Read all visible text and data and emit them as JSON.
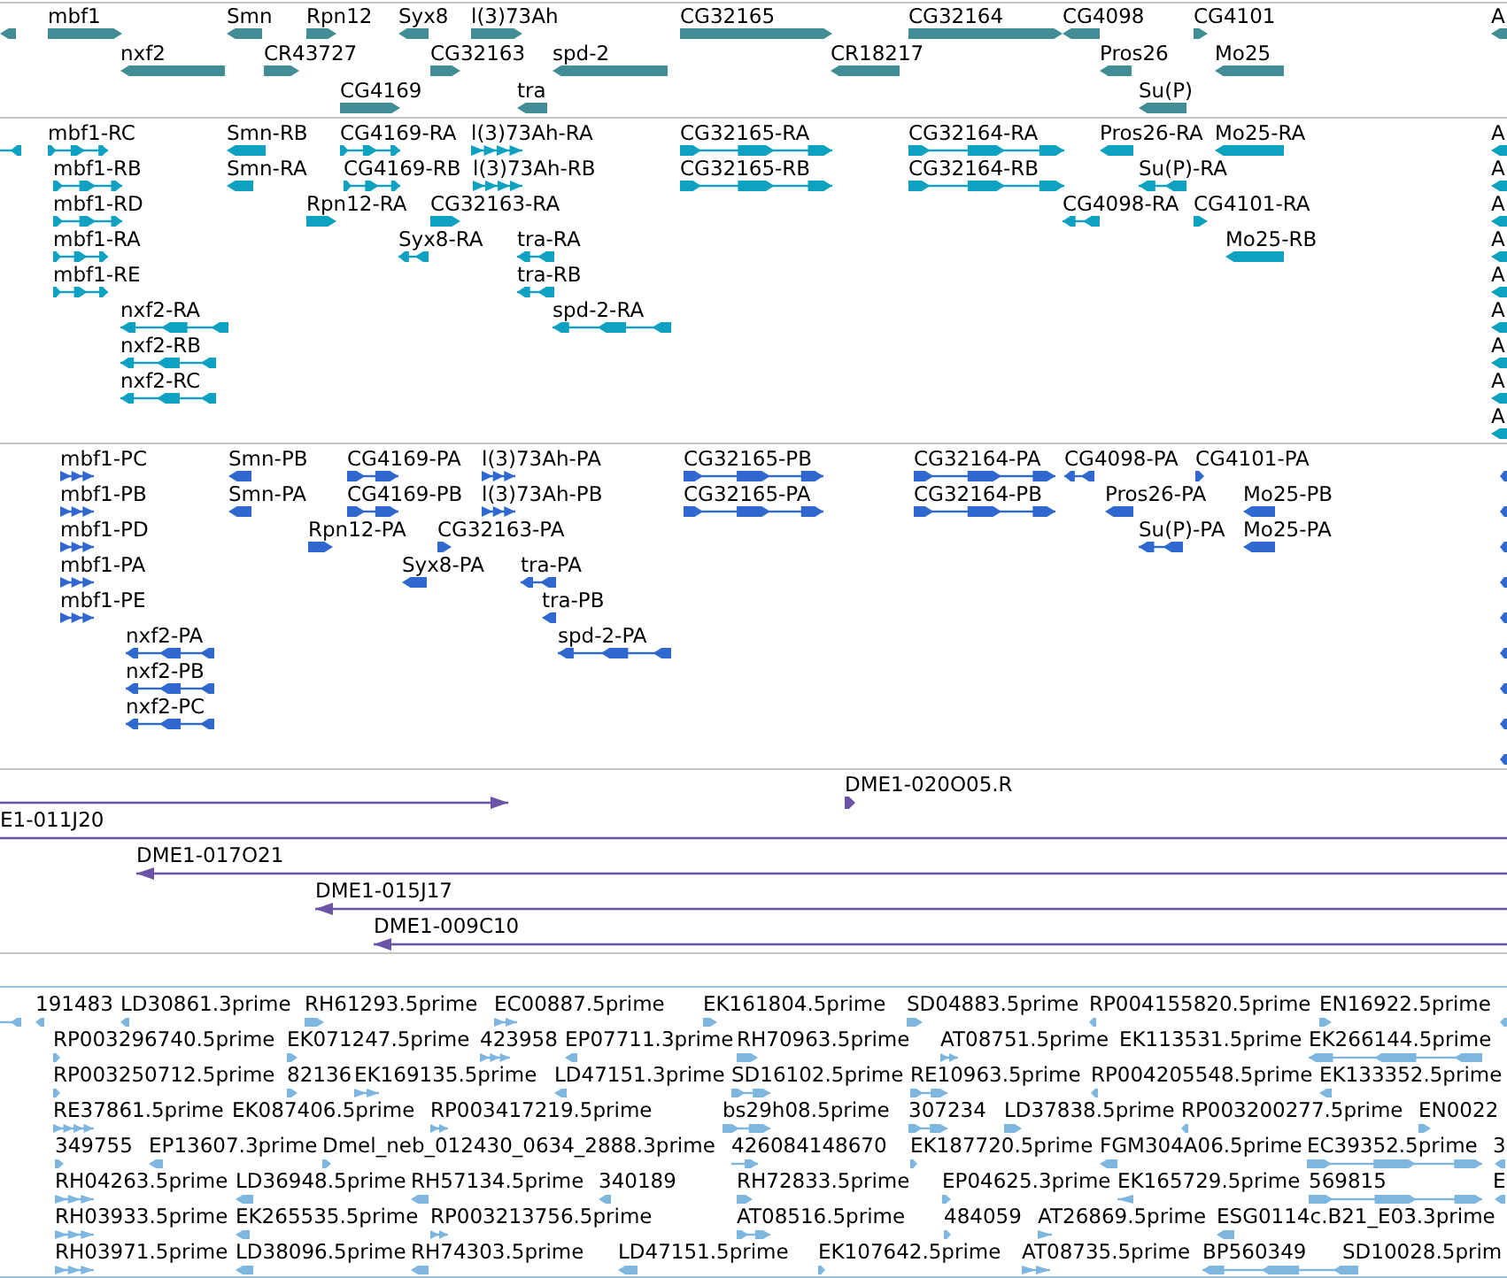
{
  "tracks": [
    {
      "kind": "gene",
      "features": [
        {
          "forward": false
        },
        {
          "label": "mbf1",
          "forward": true
        },
        {
          "label": "Smn",
          "forward": false
        },
        {
          "label": "Rpn12",
          "forward": true
        },
        {
          "label": "Syx8",
          "forward": false
        },
        {
          "label": "l(3)73Ah",
          "forward": true
        },
        {
          "label": "CG32165",
          "forward": true
        },
        {
          "label": "CG32164",
          "forward": true
        },
        {
          "label": "CG4098",
          "forward": false
        },
        {
          "label": "CG4101",
          "forward": true
        },
        {
          "label": "A",
          "forward": false
        },
        {
          "label": "nxf2",
          "forward": false
        },
        {
          "label": "CR43727",
          "forward": true
        },
        {
          "label": "CG32163",
          "forward": true
        },
        {
          "label": "spd-2",
          "forward": false
        },
        {
          "label": "CR18217",
          "forward": false
        },
        {
          "label": "Pros26",
          "forward": false
        },
        {
          "label": "Mo25",
          "forward": false
        },
        {
          "label": "CG4169",
          "forward": true
        },
        {
          "label": "tra",
          "forward": false
        },
        {
          "label": "Su(P)",
          "forward": false
        }
      ]
    },
    {
      "kind": "transcript",
      "features": [
        {
          "forward": false
        },
        {
          "label": "mbf1-RC",
          "forward": true
        },
        {
          "label": "Smn-RB",
          "forward": false
        },
        {
          "label": "CG4169-RA",
          "forward": true
        },
        {
          "label": "l(3)73Ah-RA",
          "forward": true
        },
        {
          "label": "CG32165-RA",
          "forward": true
        },
        {
          "label": "CG32164-RA",
          "forward": true
        },
        {
          "label": "Pros26-RA",
          "forward": false
        },
        {
          "label": "Mo25-RA",
          "forward": false
        },
        {
          "label": "A",
          "forward": false
        },
        {
          "label": "mbf1-RB",
          "forward": true
        },
        {
          "label": "Smn-RA",
          "forward": false
        },
        {
          "label": "CG4169-RB",
          "forward": true
        },
        {
          "label": "l(3)73Ah-RB",
          "forward": true
        },
        {
          "label": "CG32165-RB",
          "forward": true
        },
        {
          "label": "CG32164-RB",
          "forward": true
        },
        {
          "label": "Su(P)-RA",
          "forward": false
        },
        {
          "label": "A",
          "forward": false
        },
        {
          "label": "mbf1-RD",
          "forward": true
        },
        {
          "label": "Rpn12-RA",
          "forward": true
        },
        {
          "label": "CG32163-RA",
          "forward": true
        },
        {
          "label": "CG4098-RA",
          "forward": false
        },
        {
          "label": "CG4101-RA",
          "forward": true
        },
        {
          "label": "A",
          "forward": false
        },
        {
          "label": "mbf1-RA",
          "forward": true
        },
        {
          "label": "Syx8-RA",
          "forward": false
        },
        {
          "label": "tra-RA",
          "forward": false
        },
        {
          "label": "Mo25-RB",
          "forward": false
        },
        {
          "label": "A",
          "forward": false
        },
        {
          "label": "mbf1-RE",
          "forward": true
        },
        {
          "label": "tra-RB",
          "forward": false
        },
        {
          "label": "A",
          "forward": false
        },
        {
          "label": "nxf2-RA",
          "forward": false
        },
        {
          "label": "spd-2-RA",
          "forward": false
        },
        {
          "label": "A",
          "forward": false
        },
        {
          "label": "nxf2-RB",
          "forward": false
        },
        {
          "label": "A",
          "forward": false
        },
        {
          "label": "nxf2-RC",
          "forward": false
        },
        {
          "label": "A",
          "forward": false
        },
        {
          "label": "A",
          "forward": false
        }
      ]
    },
    {
      "kind": "protein",
      "features": [
        {
          "label": "mbf1-PC",
          "forward": true
        },
        {
          "label": "Smn-PB",
          "forward": false
        },
        {
          "label": "CG4169-PA",
          "forward": true
        },
        {
          "label": "l(3)73Ah-PA",
          "forward": true
        },
        {
          "label": "CG32165-PB",
          "forward": true
        },
        {
          "label": "CG32164-PA",
          "forward": true
        },
        {
          "label": "CG4098-PA",
          "forward": false
        },
        {
          "label": "CG4101-PA",
          "forward": true
        },
        {
          "forward": false
        },
        {
          "label": "mbf1-PB",
          "forward": true
        },
        {
          "label": "Smn-PA",
          "forward": false
        },
        {
          "label": "CG4169-PB",
          "forward": true
        },
        {
          "label": "l(3)73Ah-PB",
          "forward": true
        },
        {
          "label": "CG32165-PA",
          "forward": true
        },
        {
          "label": "CG32164-PB",
          "forward": true
        },
        {
          "label": "Pros26-PA",
          "forward": false
        },
        {
          "label": "Mo25-PB",
          "forward": false
        },
        {
          "forward": false
        },
        {
          "label": "mbf1-PD",
          "forward": true
        },
        {
          "label": "Rpn12-PA",
          "forward": true
        },
        {
          "label": "CG32163-PA",
          "forward": true
        },
        {
          "label": "Su(P)-PA",
          "forward": false
        },
        {
          "label": "Mo25-PA",
          "forward": false
        },
        {
          "forward": false
        },
        {
          "label": "mbf1-PA",
          "forward": true
        },
        {
          "label": "Syx8-PA",
          "forward": false
        },
        {
          "label": "tra-PA",
          "forward": false
        },
        {
          "forward": false
        },
        {
          "label": "mbf1-PE",
          "forward": true
        },
        {
          "label": "tra-PB",
          "forward": false
        },
        {
          "forward": false
        },
        {
          "label": "nxf2-PA",
          "forward": false
        },
        {
          "label": "spd-2-PA",
          "forward": false
        },
        {
          "forward": false
        },
        {
          "label": "nxf2-PB",
          "forward": false
        },
        {
          "forward": false
        },
        {
          "label": "nxf2-PC",
          "forward": false
        },
        {
          "forward": false
        },
        {
          "forward": false
        }
      ]
    },
    {
      "kind": "clone",
      "features": [
        {
          "forward": true
        },
        {
          "label": "DME1-020O05.R",
          "forward": true
        },
        {
          "label": "E1-011J20"
        },
        {
          "label": "DME1-017O21",
          "forward": false
        },
        {
          "label": "DME1-015J17",
          "forward": false
        },
        {
          "label": "DME1-009C10",
          "forward": false
        }
      ]
    },
    {
      "kind": "est",
      "features": [
        {
          "forward": false
        },
        {
          "label": "191483",
          "forward": false
        },
        {
          "label": "LD30861.3prime",
          "forward": false
        },
        {
          "label": "RH61293.5prime",
          "forward": true
        },
        {
          "label": "EC00887.5prime",
          "forward": true
        },
        {
          "label": "EK161804.5prime",
          "forward": true
        },
        {
          "label": "SD04883.5prime",
          "forward": true
        },
        {
          "label": "RP004155820.5prime",
          "forward": false
        },
        {
          "label": "EN16922.5prime",
          "forward": true
        },
        {
          "forward": false
        },
        {
          "label": "RP003296740.5prime",
          "forward": true
        },
        {
          "label": "EK071247.5prime",
          "forward": true
        },
        {
          "label": "423958",
          "forward": true
        },
        {
          "label": "EP07711.3prime",
          "forward": false
        },
        {
          "label": "RH70963.5prime",
          "forward": true
        },
        {
          "label": "AT08751.5prime",
          "forward": true
        },
        {
          "label": "EK113531.5prime"
        },
        {
          "label": "EK266144.5prime",
          "forward": false
        },
        {
          "label": "RP003250712.5prime",
          "forward": true
        },
        {
          "label": "82136",
          "forward": true
        },
        {
          "label": "EK169135.5prime",
          "forward": true
        },
        {
          "label": "LD47151.3prime",
          "forward": false
        },
        {
          "label": "SD16102.5prime",
          "forward": true
        },
        {
          "label": "RE10963.5prime",
          "forward": true
        },
        {
          "label": "RP004205548.5prime",
          "forward": false
        },
        {
          "label": "EK133352.5prime",
          "forward": false
        },
        {
          "label": "RE37861.5prime",
          "forward": true
        },
        {
          "label": "EK087406.5prime"
        },
        {
          "label": "RP003417219.5prime",
          "forward": true
        },
        {
          "label": "bs29h08.5prime",
          "forward": true
        },
        {
          "label": "307234",
          "forward": true
        },
        {
          "label": "LD37838.5prime",
          "forward": true
        },
        {
          "label": "RP003200277.5prime",
          "forward": false
        },
        {
          "label": "EN0022",
          "forward": true
        },
        {
          "label": "349755",
          "forward": true
        },
        {
          "label": "EP13607.3prime",
          "forward": false
        },
        {
          "label": "Dmel_neb_012430_0634_2888.3prime",
          "forward": true
        },
        {
          "label": "426084148670",
          "forward": true
        },
        {
          "label": "EK187720.5prime",
          "forward": true
        },
        {
          "label": "FGM304A06.5prime",
          "forward": false
        },
        {
          "label": "EC39352.5prime",
          "forward": true
        },
        {
          "label": "3",
          "forward": false
        },
        {
          "label": "RH04263.5prime",
          "forward": true
        },
        {
          "label": "LD36948.5prime",
          "forward": false
        },
        {
          "label": "RH57134.5prime",
          "forward": false
        },
        {
          "label": "340189",
          "forward": false
        },
        {
          "label": "RH72833.5prime",
          "forward": true
        },
        {
          "label": "EP04625.3prime",
          "forward": true
        },
        {
          "label": "EK165729.5prime",
          "forward": false
        },
        {
          "label": "569815",
          "forward": true
        },
        {
          "label": "E",
          "forward": false
        },
        {
          "label": "RH03933.5prime",
          "forward": true
        },
        {
          "label": "EK265535.5prime",
          "forward": false
        },
        {
          "label": "RP003213756.5prime",
          "forward": true
        },
        {
          "label": "AT08516.5prime",
          "forward": true
        },
        {
          "label": "484059",
          "forward": true
        },
        {
          "label": "AT26869.5prime",
          "forward": true
        },
        {
          "label": "ESG0114c.B21_E03.3prime",
          "forward": false
        },
        {
          "label": "RH03971.5prime",
          "forward": true
        },
        {
          "label": "LD38096.5prime",
          "forward": false
        },
        {
          "label": "RH74303.5prime",
          "forward": false
        },
        {
          "label": "LD47151.5prime",
          "forward": false
        },
        {
          "label": "EK107642.5prime",
          "forward": true
        },
        {
          "label": "AT08735.5prime",
          "forward": true
        },
        {
          "label": "BP560349",
          "forward": false
        },
        {
          "label": "SD10028.5prim"
        }
      ]
    }
  ]
}
